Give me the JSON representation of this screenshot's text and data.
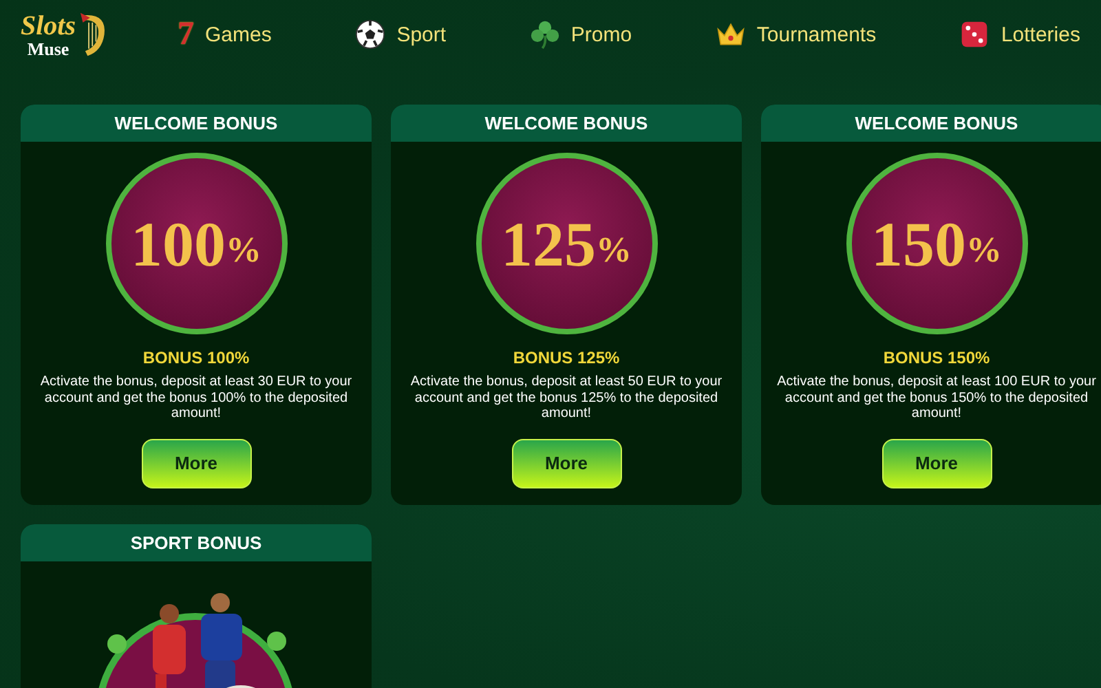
{
  "logo": {
    "line_1": "Slots",
    "line_2": "Muse"
  },
  "nav": [
    {
      "label": "Games",
      "kind": "seven",
      "glyph": "7"
    },
    {
      "label": "Sport",
      "kind": "ball"
    },
    {
      "label": "Promo",
      "kind": "clover"
    },
    {
      "label": "Tournaments",
      "kind": "crown"
    },
    {
      "label": "Lotteries",
      "kind": "dice"
    }
  ],
  "cards": [
    {
      "title": "WELCOME BONUS",
      "kind": "badge",
      "badge": "100",
      "badge_sign": "%",
      "subtitle": "BONUS 100%",
      "text": "Activate the bonus, deposit at least 30 EUR to your account and get the bonus 100% to the deposited amount!",
      "button": "More"
    },
    {
      "title": "WELCOME BONUS",
      "kind": "badge",
      "badge": "125",
      "badge_sign": "%",
      "subtitle": "BONUS 125%",
      "text": "Activate the bonus, deposit at least 50 EUR to your account and get the bonus 125% to the deposited amount!",
      "button": "More"
    },
    {
      "title": "WELCOME BONUS",
      "kind": "badge",
      "badge": "150",
      "badge_sign": "%",
      "subtitle": "BONUS 150%",
      "text": "Activate the bonus, deposit at least 100 EUR to your account and get the bonus 150% to the deposited amount!",
      "button": "More"
    },
    {
      "title": "SPORT BONUS",
      "kind": "picture"
    }
  ]
}
